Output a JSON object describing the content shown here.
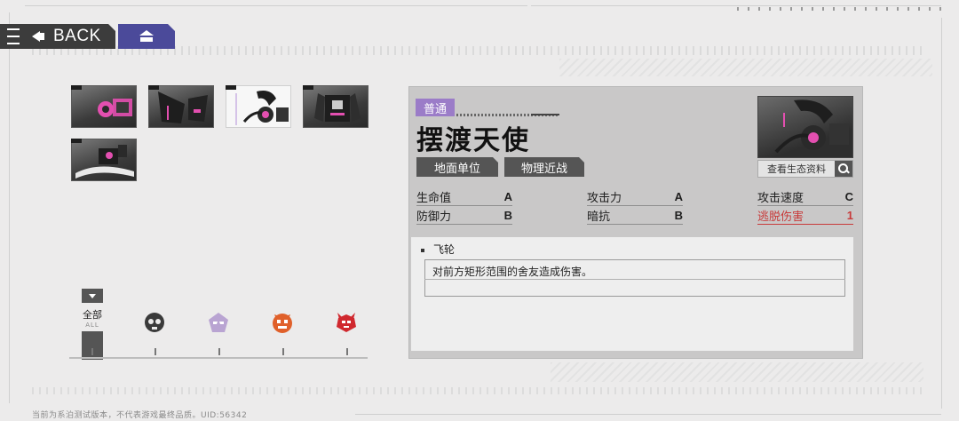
{
  "nav": {
    "back_label": "BACK"
  },
  "units": [
    {
      "name": "unit-1",
      "selected": false
    },
    {
      "name": "unit-2",
      "selected": false
    },
    {
      "name": "unit-3",
      "selected": true
    },
    {
      "name": "unit-4",
      "selected": false
    },
    {
      "name": "unit-5",
      "selected": false
    }
  ],
  "filter": {
    "all_label_zh": "全部",
    "all_label_en": "ALL",
    "factions": [
      {
        "icon": "faction-skull-icon",
        "color": "#3a3a3a"
      },
      {
        "icon": "faction-mask-icon",
        "color": "#b9a4d2"
      },
      {
        "icon": "faction-beast-icon",
        "color": "#e0602a"
      },
      {
        "icon": "faction-demon-icon",
        "color": "#d0282e"
      }
    ]
  },
  "detail": {
    "rarity": "普通",
    "rarity_color": "#9b7cc8",
    "name": "摆渡天使",
    "tags": [
      "地面单位",
      "物理近战"
    ],
    "profile_button": "查看生态资料",
    "stats": [
      {
        "label": "生命值",
        "value": "A"
      },
      {
        "label": "攻击力",
        "value": "A"
      },
      {
        "label": "攻击速度",
        "value": "C"
      },
      {
        "label": "防御力",
        "value": "B"
      },
      {
        "label": "暗抗",
        "value": "B"
      },
      {
        "label": "逃脱伤害",
        "value": "1",
        "highlight_color": "#c83a3a"
      }
    ],
    "skill": {
      "name": "飞轮",
      "description": "对前方矩形范围的舍友造成伤害。"
    }
  },
  "footer": {
    "disclaimer": "当前为系泊测试版本，不代表游戏最终品质。UID:56342"
  }
}
